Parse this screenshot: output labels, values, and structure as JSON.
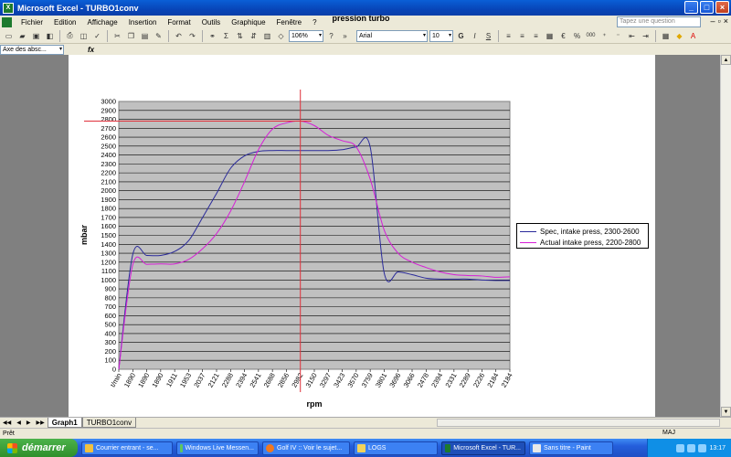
{
  "window": {
    "title": "Microsoft Excel - TURBO1conv",
    "minimize": "_",
    "maximize": "□",
    "close": "×"
  },
  "menu": {
    "items": [
      "Fichier",
      "Edition",
      "Affichage",
      "Insertion",
      "Format",
      "Outils",
      "Graphique",
      "Fenêtre",
      "?"
    ],
    "help_placeholder": "Tapez une question"
  },
  "toolbar": {
    "zoom": "106%",
    "font": "Arial",
    "size": "10",
    "bold": "G",
    "italic": "I",
    "underline": "S",
    "euro": "€",
    "percent": "%",
    "thousands": "000",
    "sigma": "Σ"
  },
  "formula_bar": {
    "name_box": "Axe des absc...",
    "fx": "fx"
  },
  "chart_data": {
    "type": "line",
    "title": "pression turbo",
    "xlabel": "rpm",
    "ylabel": "mbar",
    "ylim": [
      0,
      3000
    ],
    "ytick_step": 100,
    "categories": [
      "t/min",
      "1890",
      "1890",
      "1890",
      "1911",
      "1953",
      "2037",
      "2121",
      "2288",
      "2394",
      "2541",
      "2688",
      "2856",
      "2982",
      "3150",
      "3297",
      "3423",
      "3570",
      "3759",
      "3801",
      "3696",
      "3066",
      "2478",
      "2394",
      "2331",
      "2289",
      "2226",
      "2184",
      "2184"
    ],
    "grid": true,
    "legend": "right",
    "series": [
      {
        "name": "Spec, intake press, 2300-2600",
        "color": "#2a2a9a",
        "values": [
          0,
          1285,
          1275,
          1275,
          1320,
          1440,
          1700,
          1970,
          2250,
          2390,
          2440,
          2450,
          2450,
          2450,
          2450,
          2450,
          2460,
          2490,
          2490,
          1080,
          1090,
          1060,
          1020,
          1010,
          1010,
          1010,
          1000,
          995,
          995
        ]
      },
      {
        "name": "Actual intake press, 2200-2800",
        "color": "#d61ed6",
        "values": [
          0,
          1170,
          1175,
          1180,
          1180,
          1230,
          1350,
          1520,
          1770,
          2100,
          2460,
          2690,
          2760,
          2780,
          2730,
          2620,
          2560,
          2490,
          2130,
          1560,
          1300,
          1200,
          1140,
          1090,
          1060,
          1050,
          1045,
          1030,
          1035
        ]
      }
    ],
    "crosshair": {
      "x_category_index": 13,
      "y_value": 2780
    }
  },
  "tabs": {
    "active": "Graph1",
    "other": "TURBO1conv"
  },
  "statusbar": {
    "left": "Prêt",
    "right": "MAJ"
  },
  "taskbar": {
    "start": "démarrer",
    "buttons": [
      "Courrier entrant - se...",
      "Windows Live Messen...",
      "Golf IV :: Voir le sujet...",
      "LOGS",
      "Microsoft Excel - TUR...",
      "Sans titre - Paint"
    ],
    "clock": "13:17"
  },
  "colors": {
    "plot_bg": "#c0c0c0",
    "crosshair": "#e0303a",
    "taskbar": "#245edb"
  }
}
